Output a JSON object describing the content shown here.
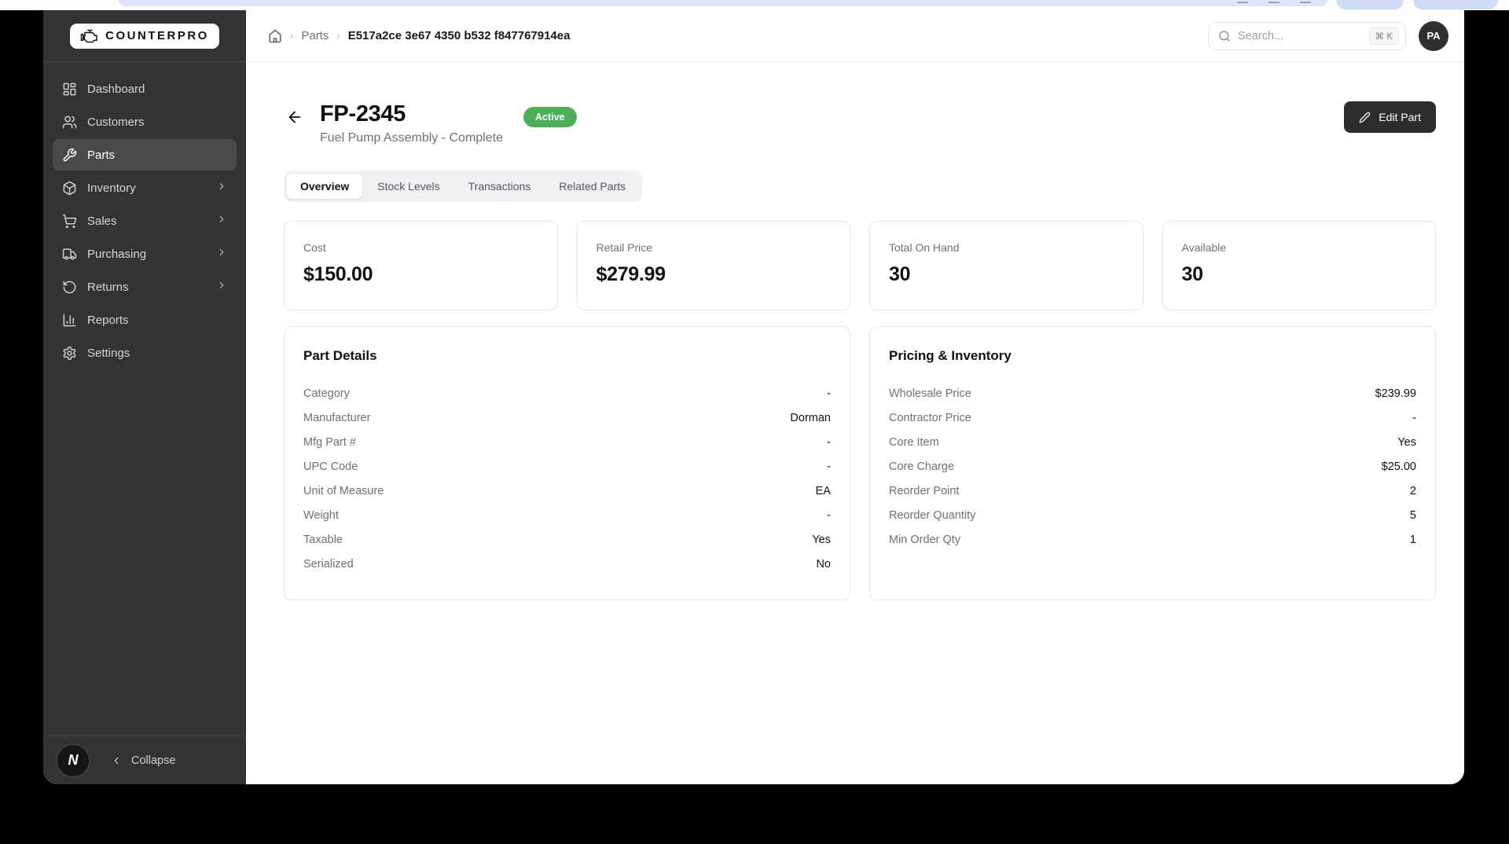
{
  "sidebar": {
    "logo_text": "COUNTERPRO",
    "items": [
      {
        "label": "Dashboard"
      },
      {
        "label": "Customers"
      },
      {
        "label": "Parts"
      },
      {
        "label": "Inventory"
      },
      {
        "label": "Sales"
      },
      {
        "label": "Purchasing"
      },
      {
        "label": "Returns"
      },
      {
        "label": "Reports"
      },
      {
        "label": "Settings"
      }
    ],
    "footer": {
      "avatar_initial": "N",
      "collapse_label": "Collapse"
    }
  },
  "header": {
    "breadcrumb": {
      "parent": "Parts",
      "current": "E517a2ce 3e67 4350 b532 f847767914ea"
    },
    "search": {
      "placeholder": "Search...",
      "shortcut": "⌘ K"
    },
    "avatar_initials": "PA"
  },
  "part": {
    "code": "FP-2345",
    "name": "Fuel Pump Assembly - Complete",
    "status": "Active",
    "edit_button_label": "Edit Part"
  },
  "tabs": [
    {
      "label": "Overview"
    },
    {
      "label": "Stock Levels"
    },
    {
      "label": "Transactions"
    },
    {
      "label": "Related Parts"
    }
  ],
  "stats": [
    {
      "label": "Cost",
      "value": "$150.00"
    },
    {
      "label": "Retail Price",
      "value": "$279.99"
    },
    {
      "label": "Total On Hand",
      "value": "30"
    },
    {
      "label": "Available",
      "value": "30"
    }
  ],
  "part_details": {
    "title": "Part Details",
    "rows": [
      {
        "label": "Category",
        "value": "-"
      },
      {
        "label": "Manufacturer",
        "value": "Dorman"
      },
      {
        "label": "Mfg Part #",
        "value": "-"
      },
      {
        "label": "UPC Code",
        "value": "-"
      },
      {
        "label": "Unit of Measure",
        "value": "EA"
      },
      {
        "label": "Weight",
        "value": "-"
      },
      {
        "label": "Taxable",
        "value": "Yes"
      },
      {
        "label": "Serialized",
        "value": "No"
      }
    ]
  },
  "pricing_inventory": {
    "title": "Pricing & Inventory",
    "rows": [
      {
        "label": "Wholesale Price",
        "value": "$239.99"
      },
      {
        "label": "Contractor Price",
        "value": "-"
      },
      {
        "label": "Core Item",
        "value": "Yes"
      },
      {
        "label": "Core Charge",
        "value": "$25.00"
      },
      {
        "label": "Reorder Point",
        "value": "2"
      },
      {
        "label": "Reorder Quantity",
        "value": "5"
      },
      {
        "label": "Min Order Qty",
        "value": "1"
      }
    ]
  },
  "colors": {
    "status_active_green": "#4caf55",
    "sidebar_bg": "#333333",
    "dark_button": "#2d2d2f",
    "address_bar_blue": "#dde4f5"
  }
}
